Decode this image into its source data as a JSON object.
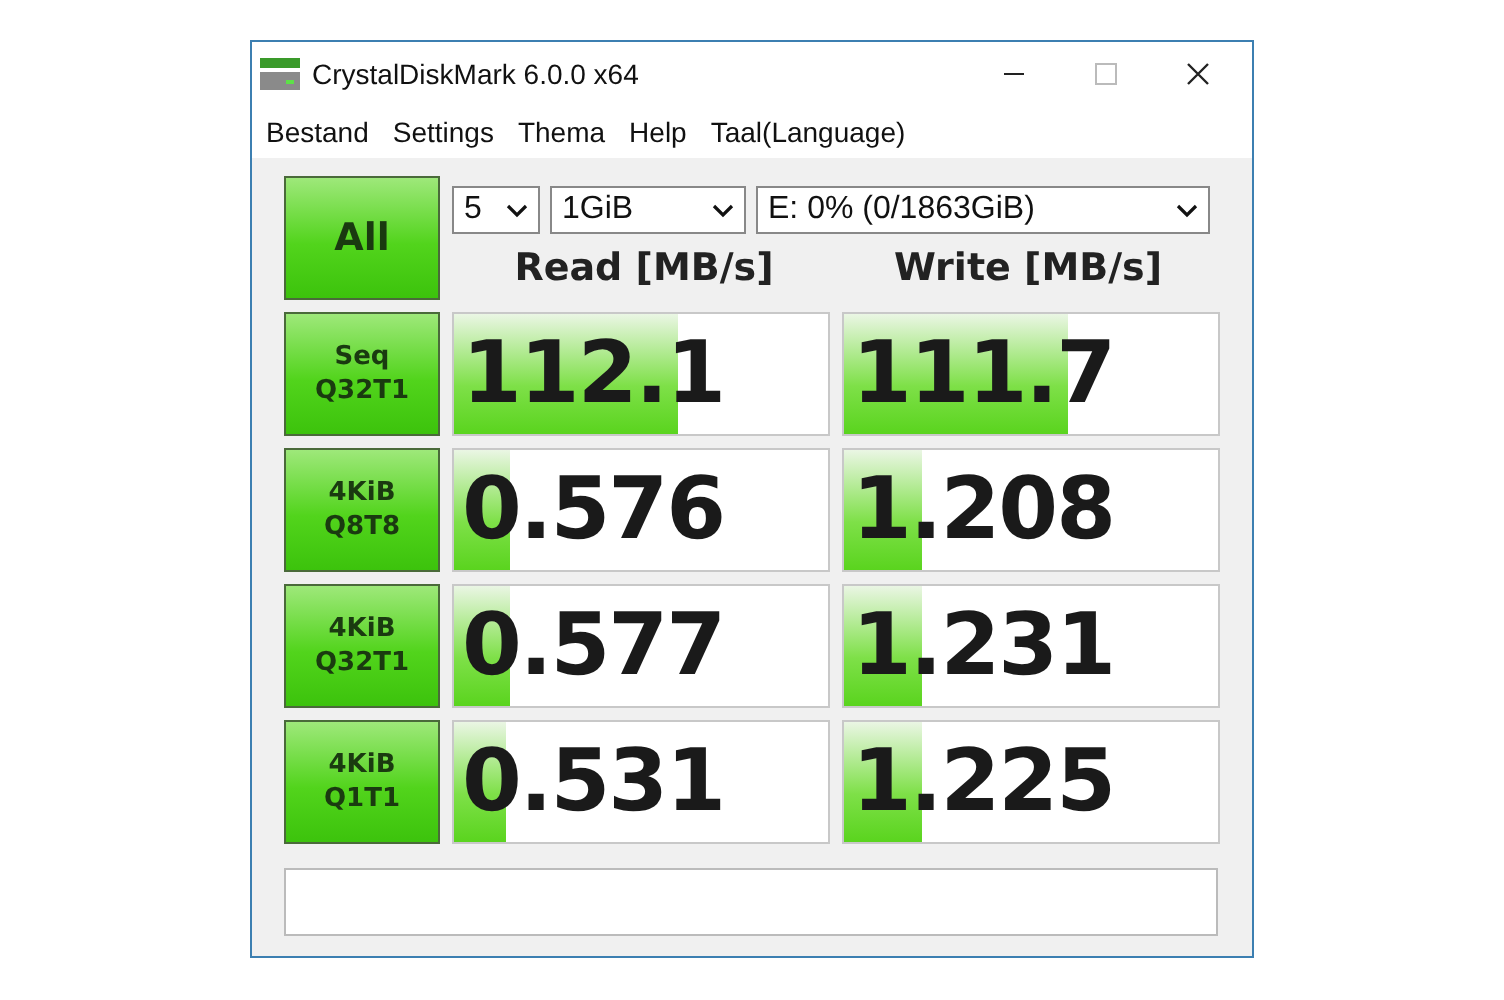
{
  "window": {
    "title": "CrystalDiskMark 6.0.0 x64"
  },
  "menu": [
    "Bestand",
    "Settings",
    "Thema",
    "Help",
    "Taal(Language)"
  ],
  "all_button": "All",
  "count_select": {
    "value": "5"
  },
  "size_select": {
    "value": "1GiB"
  },
  "drive_select": {
    "value": "E: 0% (0/1863GiB)"
  },
  "columns": [
    "Read [MB/s]",
    "Write [MB/s]"
  ],
  "tests": [
    {
      "label": [
        "Seq",
        "Q32T1"
      ],
      "read": {
        "value": "112.1",
        "level": 0.6
      },
      "write": {
        "value": "111.7",
        "level": 0.6
      }
    },
    {
      "label": [
        "4KiB",
        "Q8T8"
      ],
      "read": {
        "value": "0.576",
        "level": 0.15
      },
      "write": {
        "value": "1.208",
        "level": 0.21
      }
    },
    {
      "label": [
        "4KiB",
        "Q32T1"
      ],
      "read": {
        "value": "0.577",
        "level": 0.15
      },
      "write": {
        "value": "1.231",
        "level": 0.21
      }
    },
    {
      "label": [
        "4KiB",
        "Q1T1"
      ],
      "read": {
        "value": "0.531",
        "level": 0.14
      },
      "write": {
        "value": "1.225",
        "level": 0.21
      }
    }
  ]
}
